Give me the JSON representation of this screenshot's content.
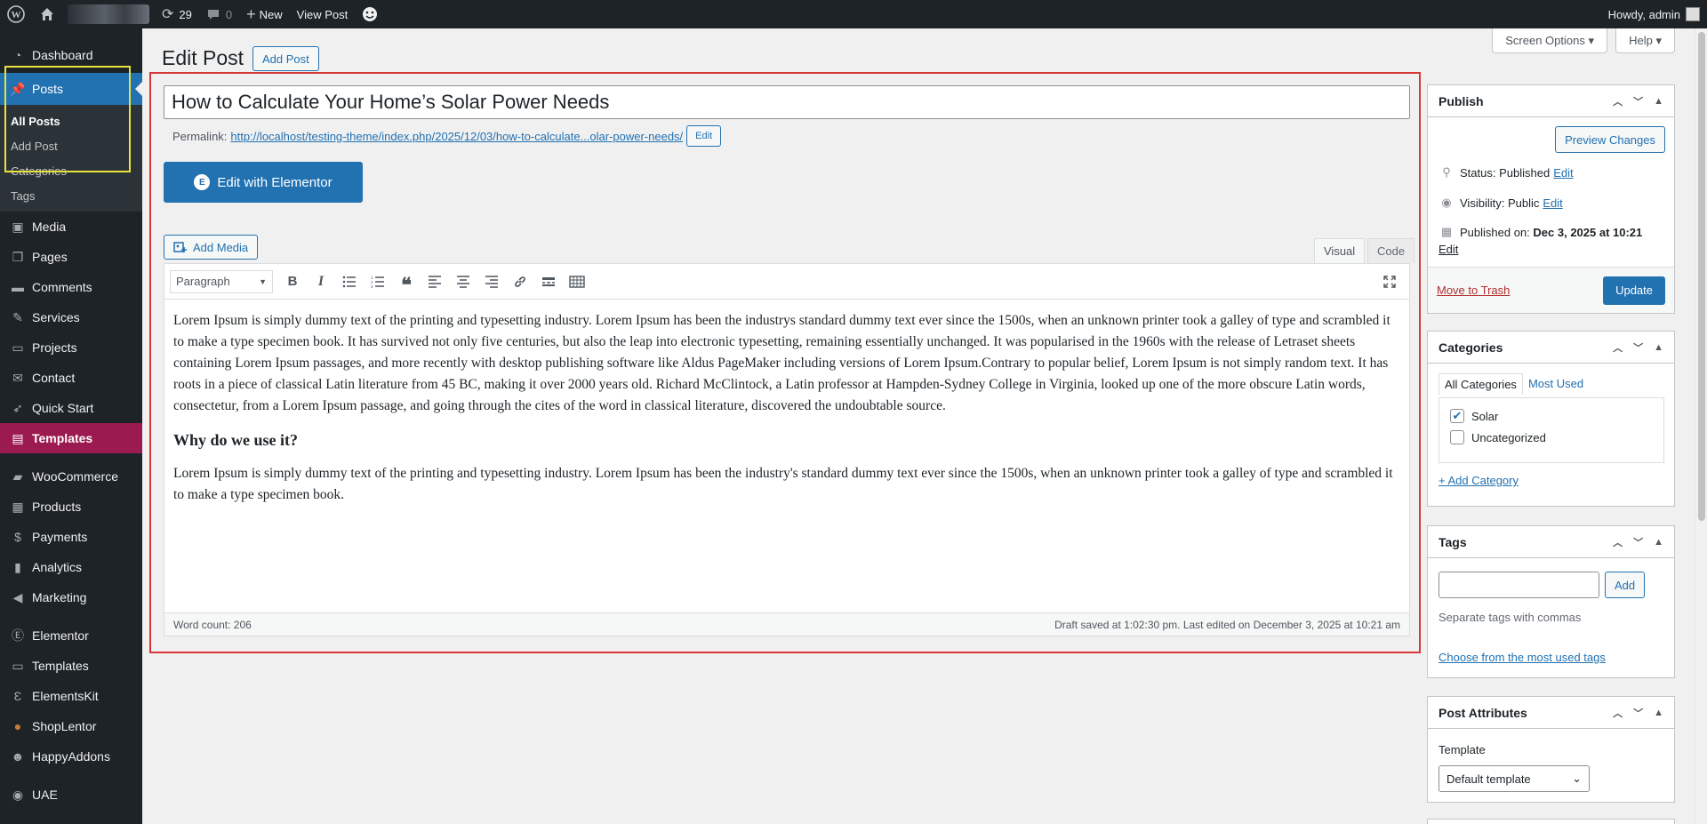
{
  "admin_bar": {
    "updates_count": "29",
    "comments_count": "0",
    "new_label": "New",
    "view_post_label": "View Post",
    "howdy": "Howdy, admin"
  },
  "sidebar": {
    "dashboard": "Dashboard",
    "posts": "Posts",
    "posts_sub": [
      "All Posts",
      "Add Post",
      "Categories",
      "Tags"
    ],
    "items": [
      "Media",
      "Pages",
      "Comments",
      "Services",
      "Projects",
      "Contact",
      "Quick Start"
    ],
    "templates_active": "Templates",
    "items2": [
      "WooCommerce",
      "Products",
      "Payments",
      "Analytics",
      "Marketing"
    ],
    "items3": [
      "Elementor",
      "Templates",
      "ElementsKit",
      "ShopLentor",
      "HappyAddons"
    ],
    "items4": [
      "UAE"
    ]
  },
  "header": {
    "title": "Edit Post",
    "add_post": "Add Post",
    "screen_options": "Screen Options ▾",
    "help": "Help ▾"
  },
  "post": {
    "title": "How to Calculate Your Home’s Solar Power Needs",
    "permalink_label": "Permalink:",
    "permalink_url": "http://localhost/testing-theme/index.php/2025/12/03/how-to-calculate...olar-power-needs/",
    "permalink_edit": "Edit",
    "elementor_btn": "Edit with Elementor",
    "add_media": "Add Media",
    "tab_visual": "Visual",
    "tab_code": "Code",
    "format": "Paragraph",
    "p1": "Lorem Ipsum is simply dummy text of the printing and typesetting industry. Lorem Ipsum has been the industrys standard dummy text ever since the 1500s, when an unknown printer took a galley of type and scrambled it to make a type specimen book. It has survived not only five centuries, but also the leap into electronic typesetting, remaining essentially unchanged. It was popularised in the 1960s with the release of Letraset sheets containing Lorem Ipsum passages, and more recently with desktop publishing software like Aldus PageMaker including versions of Lorem Ipsum.Contrary to popular belief, Lorem Ipsum is not simply random text. It has roots in a piece of classical Latin literature from 45 BC, making it over 2000 years old. Richard McClintock, a Latin professor at Hampden-Sydney College in Virginia, looked up one of the more obscure Latin words, consectetur, from a Lorem Ipsum passage, and going through the cites of the word in classical literature, discovered the undoubtable source.",
    "h3": "Why do we use it?",
    "p2": "Lorem Ipsum is simply dummy text of the printing and typesetting industry. Lorem Ipsum has been the industry's standard dummy text ever since the 1500s, when an unknown printer took a galley of type and scrambled it to make a type specimen book.",
    "word_count": "Word count: 206",
    "draft_saved": "Draft saved at 1:02:30 pm. Last edited on December 3, 2025 at 10:21 am"
  },
  "publish": {
    "title": "Publish",
    "preview": "Preview Changes",
    "status_label": "Status:",
    "status_value": "Published",
    "visibility_label": "Visibility:",
    "visibility_value": "Public",
    "published_on_label": "Published on:",
    "published_on_value": "Dec 3, 2025 at 10:21",
    "edit": "Edit",
    "trash": "Move to Trash",
    "update": "Update"
  },
  "categories": {
    "title": "Categories",
    "tab_all": "All Categories",
    "tab_most": "Most Used",
    "items": [
      {
        "label": "Solar",
        "checked": true
      },
      {
        "label": "Uncategorized",
        "checked": false
      }
    ],
    "add_category": "+ Add Category"
  },
  "tags": {
    "title": "Tags",
    "add": "Add",
    "hint": "Separate tags with commas",
    "most_used": "Choose from the most used tags"
  },
  "attributes": {
    "title": "Post Attributes",
    "template_label": "Template",
    "template_value": "Default template"
  },
  "colors": {
    "admin_bar": "#1d2327",
    "primary": "#2271b1",
    "templates_active": "#9b1a4f",
    "highlight_main": "#d63638",
    "highlight_sidebar": "#e8e23a"
  }
}
